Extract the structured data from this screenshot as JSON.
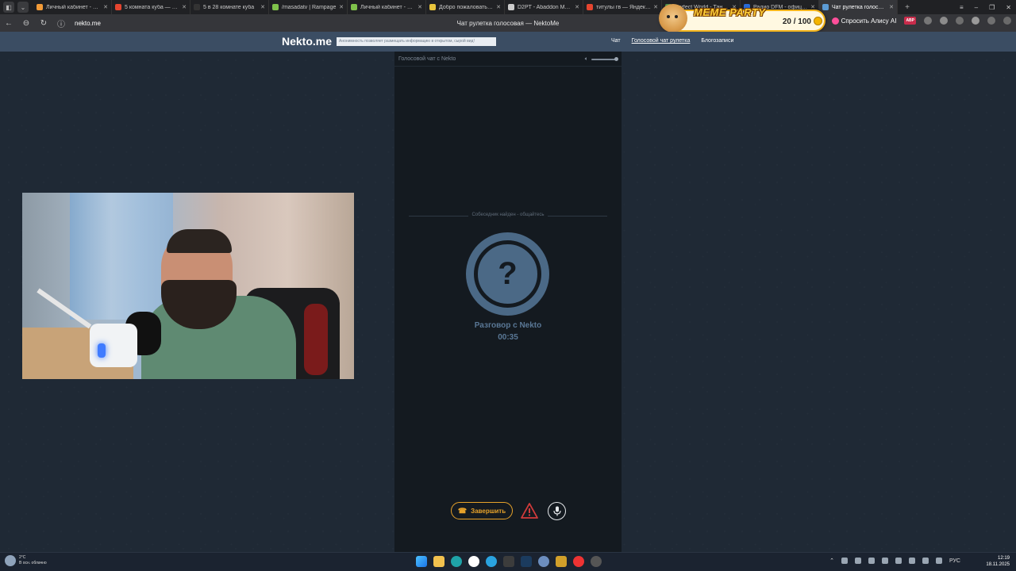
{
  "browser": {
    "tabs": [
      {
        "label": "Личный кабинет - Comet",
        "color": "#f29b38"
      },
      {
        "label": "5 комната куба — Яндекс",
        "color": "#e5452f"
      },
      {
        "label": "5 в 28 комнате куба",
        "color": "#333333"
      },
      {
        "label": "/masadatv | Rampage",
        "color": "#7fc24b"
      },
      {
        "label": "Личный кабинет - Rampage",
        "color": "#7fc24b"
      },
      {
        "label": "Добро пожаловать xsein",
        "color": "#e8c43c"
      },
      {
        "label": "D2PT - Abaddon Meta Items",
        "color": "#cccccc"
      },
      {
        "label": "титулы гв — Яндекс: нашлось",
        "color": "#e5452f"
      },
      {
        "label": "Perfect World - Танцы",
        "color": "#4d8f4a"
      },
      {
        "label": "Радио DFM - официальный",
        "color": "#2a6bd6"
      },
      {
        "label": "Чат рулетка голосовая",
        "color": "#5b9bd5",
        "active": true
      }
    ],
    "url": "nekto.me",
    "page_title": "Чат рулетка голосовая — NektoMe",
    "ask_alice": "Спросить Алису AI",
    "abp": "ABP"
  },
  "meme_party": {
    "title": "MEME PARTY",
    "count": "20 / 100"
  },
  "site": {
    "logo": "Nekto.me",
    "anon_note": "Анонимность позволяет размещать информацию в открытом, сырой вид!",
    "nav": [
      "Чат",
      "Голосовой чат рулетка",
      "Блогозаписи"
    ]
  },
  "chat": {
    "header_title": "Голосовой чат с Nekto",
    "found_text": "Собеседник найден - общайтесь",
    "avatar_symbol": "?",
    "conversation_title": "Разговор с Nekto",
    "timer": "00:35",
    "end_button": "Завершить"
  },
  "taskbar": {
    "weather_temp": "2°C",
    "weather_desc": "В осн. облачно",
    "lang": "РУС",
    "time": "12:19",
    "date": "18.11.2025"
  }
}
